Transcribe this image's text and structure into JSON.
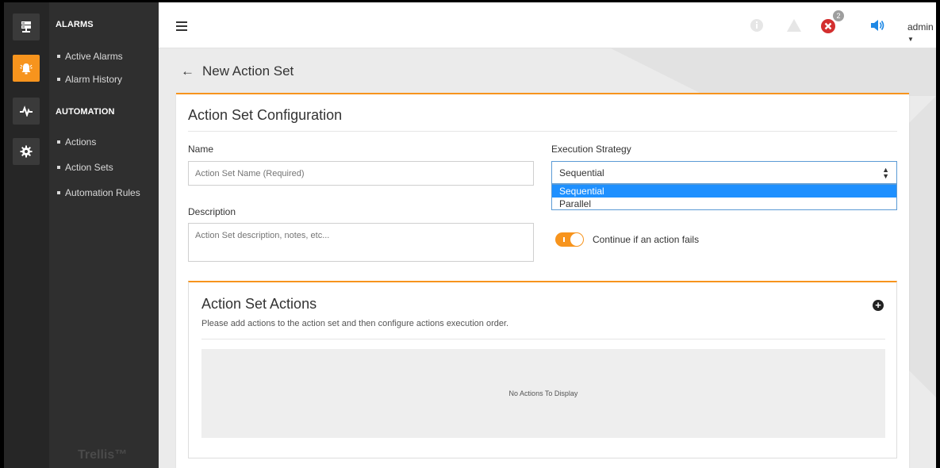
{
  "sidebar": {
    "sections": [
      {
        "heading": "ALARMS",
        "items": [
          "Active Alarms",
          "Alarm History"
        ]
      },
      {
        "heading": "AUTOMATION",
        "items": [
          "Actions",
          "Action Sets",
          "Automation Rules"
        ]
      }
    ],
    "brand": "Trellis™"
  },
  "rail": {
    "icons": [
      "server-icon",
      "alarm-bell-icon",
      "pulse-icon",
      "gear-icon"
    ],
    "active_index": 1
  },
  "topbar": {
    "icons": [
      "info-icon",
      "warning-icon",
      "critical-icon",
      "speaker-icon"
    ],
    "critical_count": "2",
    "user": "admin"
  },
  "page": {
    "title": "New Action Set"
  },
  "config": {
    "title": "Action Set Configuration",
    "name_label": "Name",
    "name_placeholder": "Action Set Name (Required)",
    "description_label": "Description",
    "description_placeholder": "Action Set description, notes, etc...",
    "strategy_label": "Execution Strategy",
    "strategy_value": "Sequential",
    "strategy_options": [
      "Sequential",
      "Parallel"
    ],
    "continue_label": "Continue if an action fails",
    "continue_enabled": true
  },
  "actions_panel": {
    "title": "Action Set Actions",
    "subtitle": "Please add actions to the action set and then configure actions execution order.",
    "empty_text": "No Actions To Display"
  },
  "colors": {
    "accent": "#f7941d",
    "critical": "#d32f2f",
    "speaker": "#1e88e5",
    "select_highlight": "#1e90ff"
  }
}
